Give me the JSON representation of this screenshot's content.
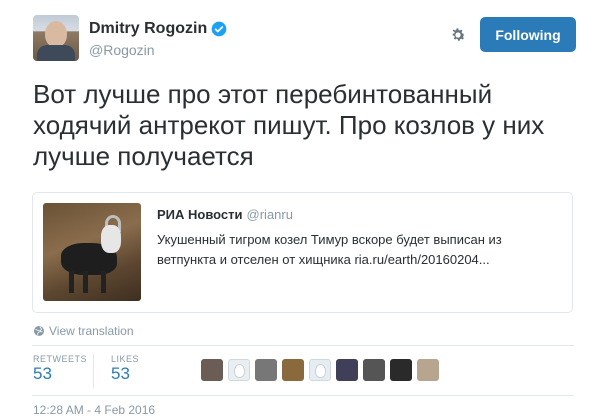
{
  "author": {
    "name": "Dmitry Rogozin",
    "handle": "@Rogozin",
    "verified_color": "#1da1f2",
    "avatar_icon": "profile-photo"
  },
  "actions": {
    "follow_label": "Following",
    "follow_color": "#2b7bb9",
    "settings_icon": "gear-icon"
  },
  "tweet": {
    "text": "Вот лучше про этот перебинтованный ходячий антрекот пишут. Про козлов у них лучше получается"
  },
  "quoted": {
    "name": "РИА Новости",
    "handle": "@rianru",
    "text": "Укушенный тигром козел Тимур вскоре будет выписан из ветпункта и отселен от хищника ria.ru/earth/20160204...",
    "image_icon": "goat-photo"
  },
  "translate_label": "View translation",
  "stats": {
    "retweets_label": "RETWEETS",
    "retweets_value": "53",
    "likes_label": "LIKES",
    "likes_value": "53"
  },
  "favoriters": [
    {
      "color": "#6b5d55"
    },
    {
      "color": "#e9eef2"
    },
    {
      "color": "#777777"
    },
    {
      "color": "#8a6a3c"
    },
    {
      "color": "#e6edf2"
    },
    {
      "color": "#3f3f5a"
    },
    {
      "color": "#555555"
    },
    {
      "color": "#2a2a2a"
    },
    {
      "color": "#b7a590"
    }
  ],
  "timestamp": "12:28 AM - 4 Feb 2016"
}
